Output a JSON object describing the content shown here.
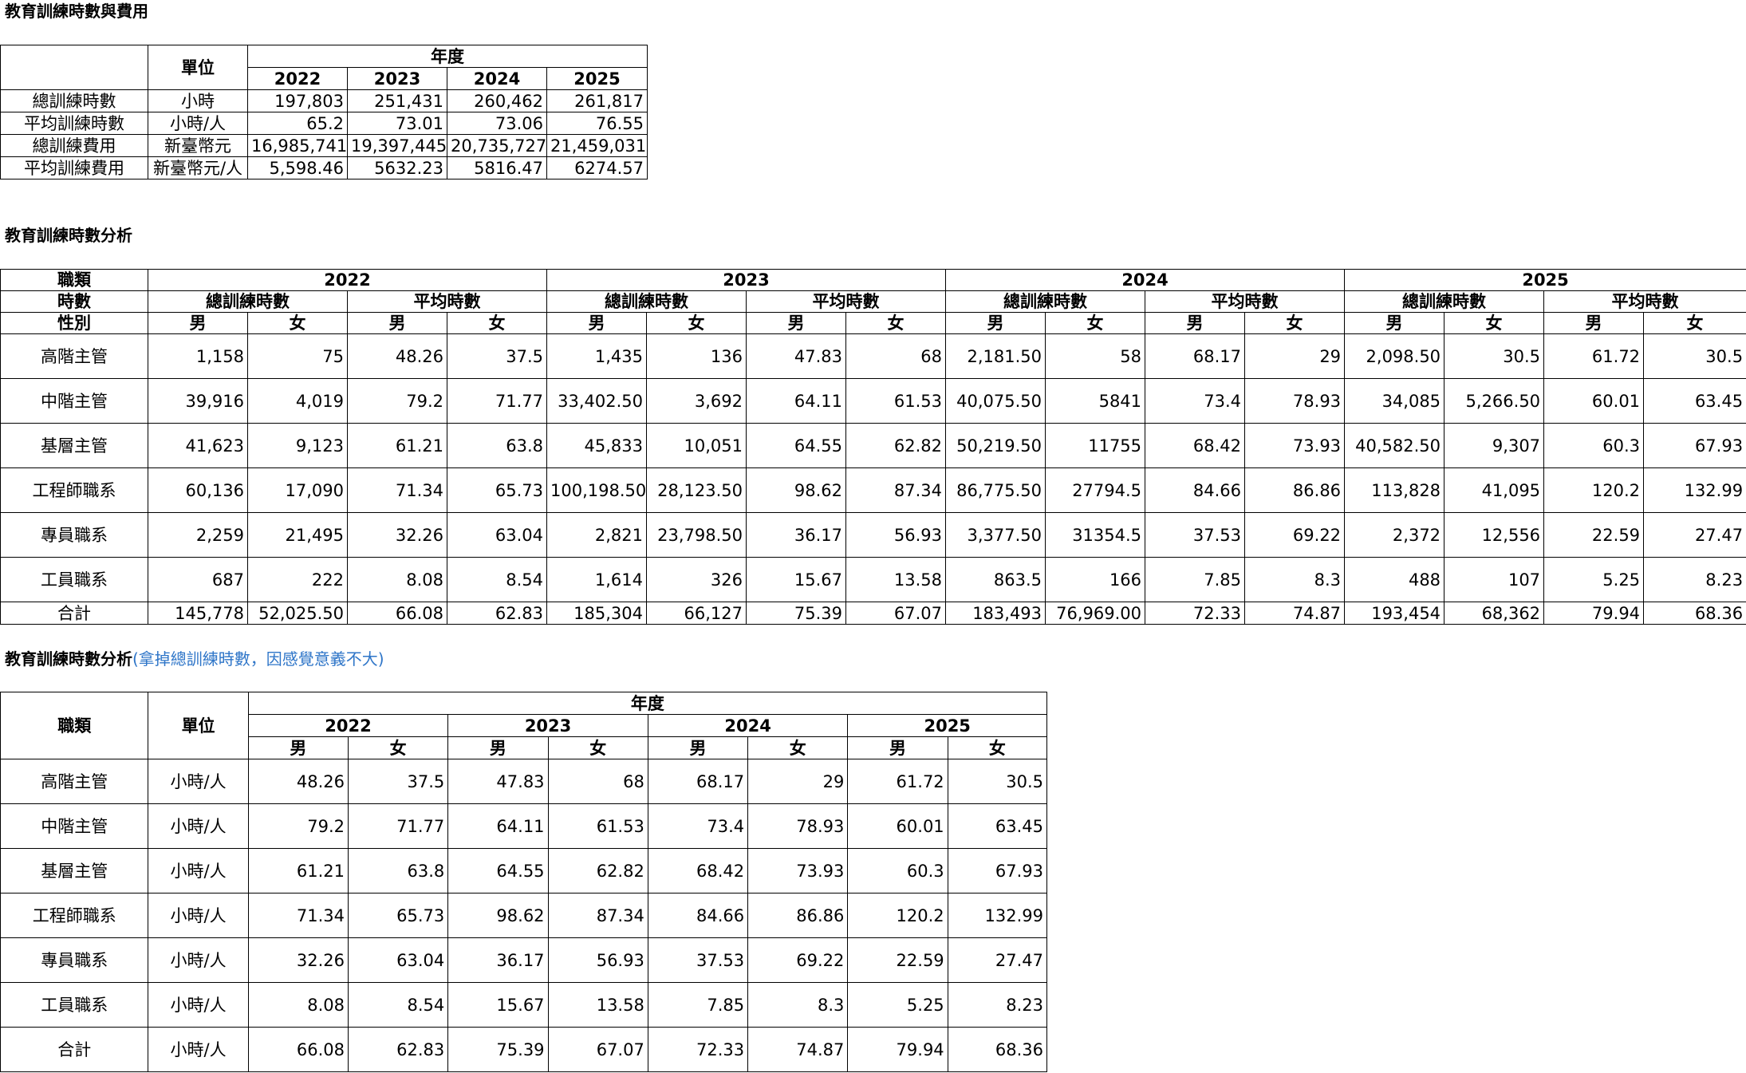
{
  "section1": {
    "title": "教育訓練時數與費用",
    "unit_header": "單位",
    "year_header": "年度",
    "years": [
      "2022",
      "2023",
      "2024",
      "2025"
    ],
    "rows": [
      {
        "label": "總訓練時數",
        "unit": "小時",
        "values": [
          "197,803",
          "251,431",
          "260,462",
          "261,817"
        ]
      },
      {
        "label": "平均訓練時數",
        "unit": "小時/人",
        "values": [
          "65.2",
          "73.01",
          "73.06",
          "76.55"
        ]
      },
      {
        "label": "總訓練費用",
        "unit": "新臺幣元",
        "values": [
          "16,985,741",
          "19,397,445",
          "20,735,727",
          "21,459,031"
        ]
      },
      {
        "label": "平均訓練費用",
        "unit": "新臺幣元/人",
        "values": [
          "5,598.46",
          "5632.23",
          "5816.47",
          "6274.57"
        ]
      }
    ]
  },
  "section2": {
    "title": "教育訓練時數分析",
    "row_headers": [
      "職類",
      "時數",
      "性別"
    ],
    "years": [
      "2022",
      "2023",
      "2024",
      "2025"
    ],
    "metrics": [
      "總訓練時數",
      "平均時數"
    ],
    "genders": [
      "男",
      "女"
    ],
    "rows": [
      {
        "label": "高階主管",
        "values": [
          "1,158",
          "75",
          "48.26",
          "37.5",
          "1,435",
          "136",
          "47.83",
          "68",
          "2,181.50",
          "58",
          "68.17",
          "29",
          "2,098.50",
          "30.5",
          "61.72",
          "30.5"
        ]
      },
      {
        "label": "中階主管",
        "values": [
          "39,916",
          "4,019",
          "79.2",
          "71.77",
          "33,402.50",
          "3,692",
          "64.11",
          "61.53",
          "40,075.50",
          "5841",
          "73.4",
          "78.93",
          "34,085",
          "5,266.50",
          "60.01",
          "63.45"
        ]
      },
      {
        "label": "基層主管",
        "values": [
          "41,623",
          "9,123",
          "61.21",
          "63.8",
          "45,833",
          "10,051",
          "64.55",
          "62.82",
          "50,219.50",
          "11755",
          "68.42",
          "73.93",
          "40,582.50",
          "9,307",
          "60.3",
          "67.93"
        ]
      },
      {
        "label": "工程師職系",
        "values": [
          "60,136",
          "17,090",
          "71.34",
          "65.73",
          "100,198.50",
          "28,123.50",
          "98.62",
          "87.34",
          "86,775.50",
          "27794.5",
          "84.66",
          "86.86",
          "113,828",
          "41,095",
          "120.2",
          "132.99"
        ]
      },
      {
        "label": "專員職系",
        "values": [
          "2,259",
          "21,495",
          "32.26",
          "63.04",
          "2,821",
          "23,798.50",
          "36.17",
          "56.93",
          "3,377.50",
          "31354.5",
          "37.53",
          "69.22",
          "2,372",
          "12,556",
          "22.59",
          "27.47"
        ]
      },
      {
        "label": "工員職系",
        "values": [
          "687",
          "222",
          "8.08",
          "8.54",
          "1,614",
          "326",
          "15.67",
          "13.58",
          "863.5",
          "166",
          "7.85",
          "8.3",
          "488",
          "107",
          "5.25",
          "8.23"
        ]
      }
    ],
    "total": {
      "label": "合計",
      "values": [
        "145,778",
        "52,025.50",
        "66.08",
        "62.83",
        "185,304",
        "66,127",
        "75.39",
        "67.07",
        "183,493",
        "76,969.00",
        "72.33",
        "74.87",
        "193,454",
        "68,362",
        "79.94",
        "68.36"
      ]
    }
  },
  "section3": {
    "title": "教育訓練時數分析",
    "note": "(拿掉總訓練時數，因感覺意義不大)",
    "category_header": "職類",
    "unit_header": "單位",
    "year_header": "年度",
    "years": [
      "2022",
      "2023",
      "2024",
      "2025"
    ],
    "genders": [
      "男",
      "女"
    ],
    "rows": [
      {
        "label": "高階主管",
        "unit": "小時/人",
        "values": [
          "48.26",
          "37.5",
          "47.83",
          "68",
          "68.17",
          "29",
          "61.72",
          "30.5"
        ]
      },
      {
        "label": "中階主管",
        "unit": "小時/人",
        "values": [
          "79.2",
          "71.77",
          "64.11",
          "61.53",
          "73.4",
          "78.93",
          "60.01",
          "63.45"
        ]
      },
      {
        "label": "基層主管",
        "unit": "小時/人",
        "values": [
          "61.21",
          "63.8",
          "64.55",
          "62.82",
          "68.42",
          "73.93",
          "60.3",
          "67.93"
        ]
      },
      {
        "label": "工程師職系",
        "unit": "小時/人",
        "values": [
          "71.34",
          "65.73",
          "98.62",
          "87.34",
          "84.66",
          "86.86",
          "120.2",
          "132.99"
        ]
      },
      {
        "label": "專員職系",
        "unit": "小時/人",
        "values": [
          "32.26",
          "63.04",
          "36.17",
          "56.93",
          "37.53",
          "69.22",
          "22.59",
          "27.47"
        ]
      },
      {
        "label": "工員職系",
        "unit": "小時/人",
        "values": [
          "8.08",
          "8.54",
          "15.67",
          "13.58",
          "7.85",
          "8.3",
          "5.25",
          "8.23"
        ]
      },
      {
        "label": "合計",
        "unit": "小時/人",
        "values": [
          "66.08",
          "62.83",
          "75.39",
          "67.07",
          "72.33",
          "74.87",
          "79.94",
          "68.36"
        ]
      }
    ]
  }
}
